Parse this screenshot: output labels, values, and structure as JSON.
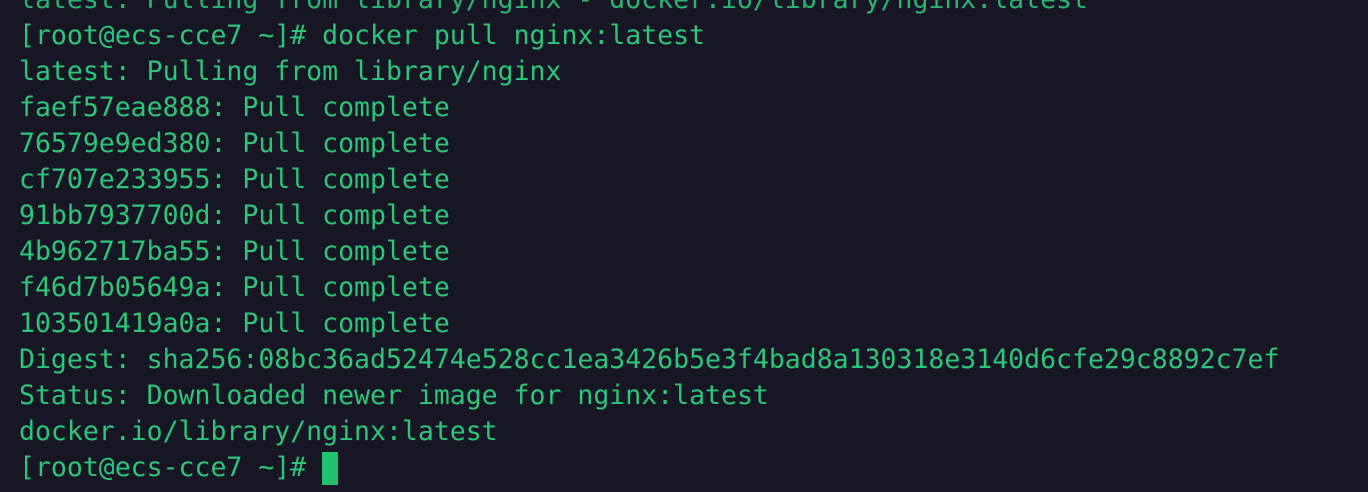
{
  "terminal": {
    "partial_top_line": "latest: Pulling from library/nginx - docker.io/library/nginx:latest",
    "lines": [
      {
        "prompt": "[root@ecs-cce7 ~]# ",
        "command": "docker pull nginx:latest"
      },
      {
        "text": "latest: Pulling from library/nginx"
      },
      {
        "text": "faef57eae888: Pull complete"
      },
      {
        "text": "76579e9ed380: Pull complete"
      },
      {
        "text": "cf707e233955: Pull complete"
      },
      {
        "text": "91bb7937700d: Pull complete"
      },
      {
        "text": "4b962717ba55: Pull complete"
      },
      {
        "text": "f46d7b05649a: Pull complete"
      },
      {
        "text": "103501419a0a: Pull complete"
      },
      {
        "text": "Digest: sha256:08bc36ad52474e528cc1ea3426b5e3f4bad8a130318e3140d6cfe29c8892c7ef"
      },
      {
        "text": "Status: Downloaded newer image for nginx:latest"
      },
      {
        "text": "docker.io/library/nginx:latest"
      }
    ],
    "final_prompt": "[root@ecs-cce7 ~]#",
    "colors": {
      "background": "#161624",
      "text": "#2ec47a",
      "cursor": "#22c06e"
    }
  }
}
